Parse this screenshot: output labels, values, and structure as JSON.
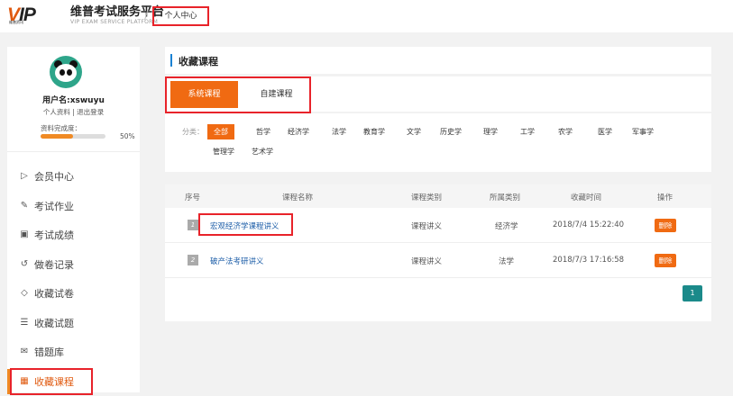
{
  "header": {
    "logo_mark": "VIP",
    "logo_sub": "维普资讯",
    "brand_title": "维普考试服务平台",
    "brand_en": "VIP EXAM SERVICE PLATFORM",
    "separator": "/",
    "breadcrumb": "个人中心"
  },
  "profile": {
    "username": "用户名:xswuyu",
    "profile_link": "个人资料",
    "divider": "|",
    "logout_link": "退出登录",
    "completion_label": "资料完成度：",
    "completion_value": 0.5,
    "completion_text": "50%"
  },
  "menu": [
    {
      "label": "会员中心",
      "icon": "member-center-icon",
      "glyph": "▷"
    },
    {
      "label": "考试作业",
      "icon": "exam-homework-icon",
      "glyph": "✎"
    },
    {
      "label": "考试成绩",
      "icon": "exam-score-icon",
      "glyph": "▣"
    },
    {
      "label": "做卷记录",
      "icon": "history-icon",
      "glyph": "↺"
    },
    {
      "label": "收藏试卷",
      "icon": "collect-paper-icon",
      "glyph": "◇"
    },
    {
      "label": "收藏试题",
      "icon": "collect-question-icon",
      "glyph": "☰"
    },
    {
      "label": "错题库",
      "icon": "wrong-question-icon",
      "glyph": "✉"
    },
    {
      "label": "收藏课程",
      "icon": "collect-course-icon",
      "glyph": "▦",
      "active": true
    }
  ],
  "main": {
    "section_title": "收藏课程",
    "tabs": [
      {
        "label": "系统课程",
        "selected": true
      },
      {
        "label": "自建课程",
        "selected": false
      }
    ],
    "filter_label": "分类：",
    "categories": [
      "全部",
      "哲学",
      "经济学",
      "法学",
      "教育学",
      "文学",
      "历史学",
      "理学",
      "工学",
      "农学",
      "医学",
      "军事学",
      "管理学",
      "艺术学"
    ],
    "selected_category": "全部",
    "table": {
      "headers": [
        "序号",
        "课程名称",
        "课程类别",
        "所属类别",
        "收藏时间",
        "操作"
      ],
      "rows": [
        {
          "index": "1",
          "name": "宏观经济学课程讲义",
          "type": "课程讲义",
          "category": "经济学",
          "time": "2018/7/4 15:22:40",
          "action": "删除"
        },
        {
          "index": "2",
          "name": "破产法考研讲义",
          "type": "课程讲义",
          "category": "法学",
          "time": "2018/7/3 17:16:58",
          "action": "删除"
        }
      ]
    },
    "pagination": {
      "current": "1"
    }
  },
  "colors": {
    "accent": "#f06a12",
    "highlight_border": "#e8232a",
    "link": "#1d5ea8",
    "page_button": "#1b8a8a",
    "section_bar": "#1a82d3"
  }
}
